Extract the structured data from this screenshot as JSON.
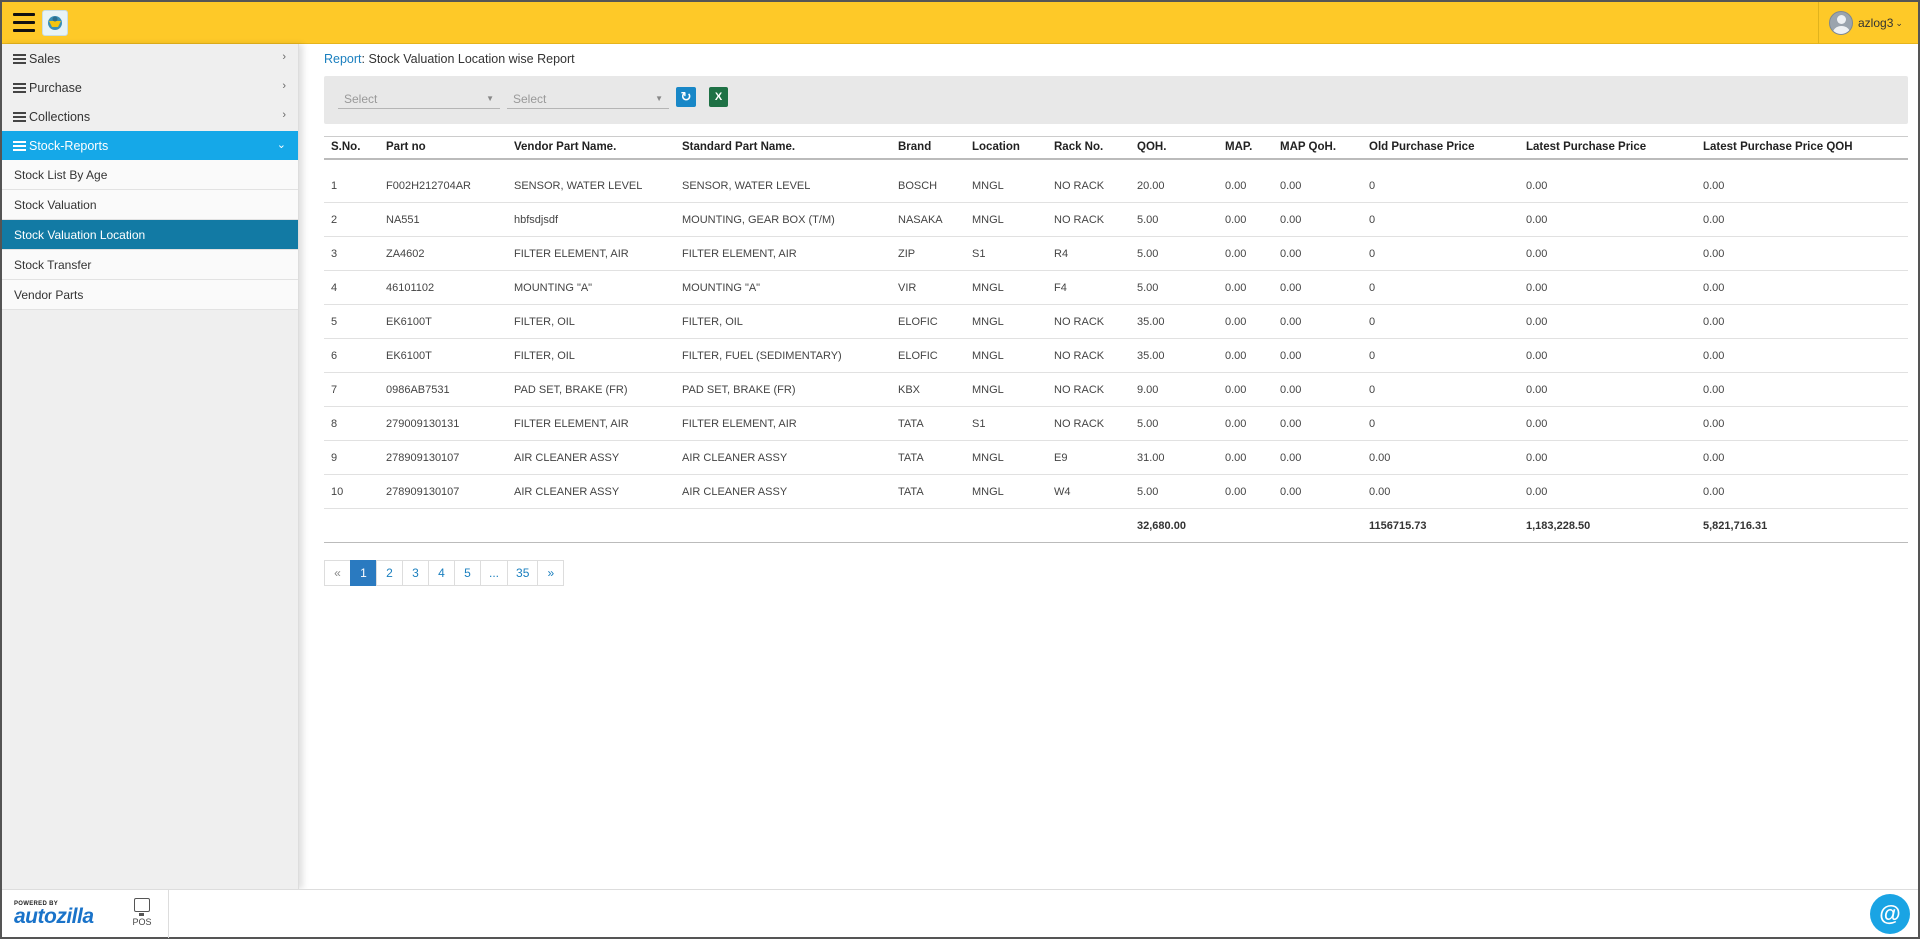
{
  "header": {
    "username": "azlog3"
  },
  "sidebar": {
    "menu": [
      {
        "label": "Sales"
      },
      {
        "label": "Purchase"
      },
      {
        "label": "Collections"
      },
      {
        "label": "Stock-Reports"
      }
    ],
    "submenu": [
      {
        "label": "Stock List By Age"
      },
      {
        "label": "Stock Valuation"
      },
      {
        "label": "Stock Valuation Location"
      },
      {
        "label": "Stock Transfer"
      },
      {
        "label": "Vendor Parts"
      }
    ]
  },
  "breadcrumb": {
    "link": "Report",
    "sep": ":",
    "title": " Stock Valuation Location wise Report"
  },
  "filters": {
    "select1": "Select",
    "select2": "Select",
    "excel_label": "X"
  },
  "table": {
    "columns": [
      "S.No.",
      "Part no",
      "Vendor Part Name.",
      "Standard Part Name.",
      "Brand",
      "Location",
      "Rack No.",
      "QOH.",
      "MAP.",
      "MAP QoH.",
      "Old Purchase Price",
      "Latest Purchase Price",
      "Latest Purchase Price QOH"
    ],
    "rows": [
      [
        "1",
        "F002H212704AR",
        "SENSOR, WATER LEVEL",
        "SENSOR, WATER LEVEL",
        "BOSCH",
        "MNGL",
        "NO RACK",
        "20.00",
        "0.00",
        "0.00",
        "0",
        "0.00",
        "0.00"
      ],
      [
        "2",
        "NA551",
        "hbfsdjsdf",
        "MOUNTING, GEAR BOX (T/M)",
        "NASAKA",
        "MNGL",
        "NO RACK",
        "5.00",
        "0.00",
        "0.00",
        "0",
        "0.00",
        "0.00"
      ],
      [
        "3",
        "ZA4602",
        "FILTER ELEMENT, AIR",
        "FILTER ELEMENT, AIR",
        "ZIP",
        "S1",
        "R4",
        "5.00",
        "0.00",
        "0.00",
        "0",
        "0.00",
        "0.00"
      ],
      [
        "4",
        "46101102",
        "MOUNTING \"A\"",
        "MOUNTING \"A\"",
        "VIR",
        "MNGL",
        "F4",
        "5.00",
        "0.00",
        "0.00",
        "0",
        "0.00",
        "0.00"
      ],
      [
        "5",
        "EK6100T",
        "FILTER, OIL",
        "FILTER, OIL",
        "ELOFIC",
        "MNGL",
        "NO RACK",
        "35.00",
        "0.00",
        "0.00",
        "0",
        "0.00",
        "0.00"
      ],
      [
        "6",
        "EK6100T",
        "FILTER, OIL",
        "FILTER, FUEL (SEDIMENTARY)",
        "ELOFIC",
        "MNGL",
        "NO RACK",
        "35.00",
        "0.00",
        "0.00",
        "0",
        "0.00",
        "0.00"
      ],
      [
        "7",
        "0986AB7531",
        "PAD SET, BRAKE (FR)",
        "PAD SET, BRAKE (FR)",
        "KBX",
        "MNGL",
        "NO RACK",
        "9.00",
        "0.00",
        "0.00",
        "0",
        "0.00",
        "0.00"
      ],
      [
        "8",
        "279009130131",
        "FILTER ELEMENT, AIR",
        "FILTER ELEMENT, AIR",
        "TATA",
        "S1",
        "NO RACK",
        "5.00",
        "0.00",
        "0.00",
        "0",
        "0.00",
        "0.00"
      ],
      [
        "9",
        "278909130107",
        "AIR CLEANER ASSY",
        "AIR CLEANER ASSY",
        "TATA",
        "MNGL",
        "E9",
        "31.00",
        "0.00",
        "0.00",
        "0.00",
        "0.00",
        "0.00"
      ],
      [
        "10",
        "278909130107",
        "AIR CLEANER ASSY",
        "AIR CLEANER ASSY",
        "TATA",
        "MNGL",
        "W4",
        "5.00",
        "0.00",
        "0.00",
        "0.00",
        "0.00",
        "0.00"
      ]
    ],
    "totals": {
      "qoh": "32,680.00",
      "old_price": "1156715.73",
      "latest_price": "1,183,228.50",
      "latest_qoh": "5,821,716.31"
    }
  },
  "pagination": {
    "pages": [
      "«",
      "1",
      "2",
      "3",
      "4",
      "5",
      "...",
      "35",
      "»"
    ],
    "current": "1"
  },
  "footer": {
    "powered_by": "POWERED BY",
    "brand": "autozilla",
    "pos_label": "POS"
  }
}
